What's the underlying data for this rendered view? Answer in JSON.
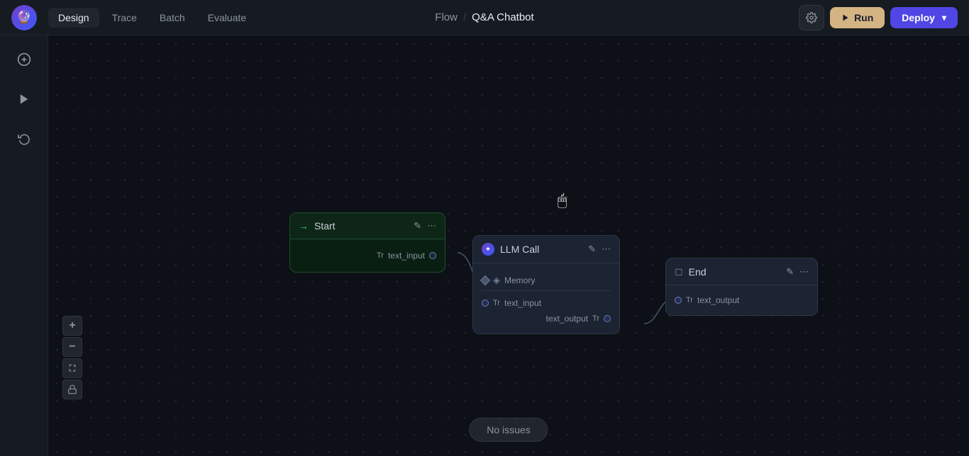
{
  "app": {
    "logo": "🔮",
    "nav": {
      "tabs": [
        {
          "id": "design",
          "label": "Design",
          "active": true
        },
        {
          "id": "trace",
          "label": "Trace",
          "active": false
        },
        {
          "id": "batch",
          "label": "Batch",
          "active": false
        },
        {
          "id": "evaluate",
          "label": "Evaluate",
          "active": false
        }
      ]
    },
    "breadcrumb": {
      "parent": "Flow",
      "separator": "/",
      "current": "Q&A Chatbot"
    },
    "toolbar": {
      "settings_label": "⚙",
      "run_label": "Run",
      "deploy_label": "Deploy"
    }
  },
  "sidebar": {
    "add_icon": "+",
    "play_icon": "▶",
    "history_icon": "↩"
  },
  "canvas": {
    "status": "No issues",
    "zoom": {
      "plus": "+",
      "minus": "−",
      "fit": "⛶",
      "lock": "🔒"
    }
  },
  "nodes": {
    "start": {
      "title": "Start",
      "port_out": "text_input",
      "edit_icon": "✎",
      "more_icon": "⋯"
    },
    "llm": {
      "title": "LLM Call",
      "memory_label": "Memory",
      "port_in": "text_input",
      "port_out": "text_output",
      "edit_icon": "✎",
      "more_icon": "⋯"
    },
    "end": {
      "title": "End",
      "port_in": "text_output",
      "edit_icon": "✎",
      "more_icon": "⋯"
    }
  }
}
